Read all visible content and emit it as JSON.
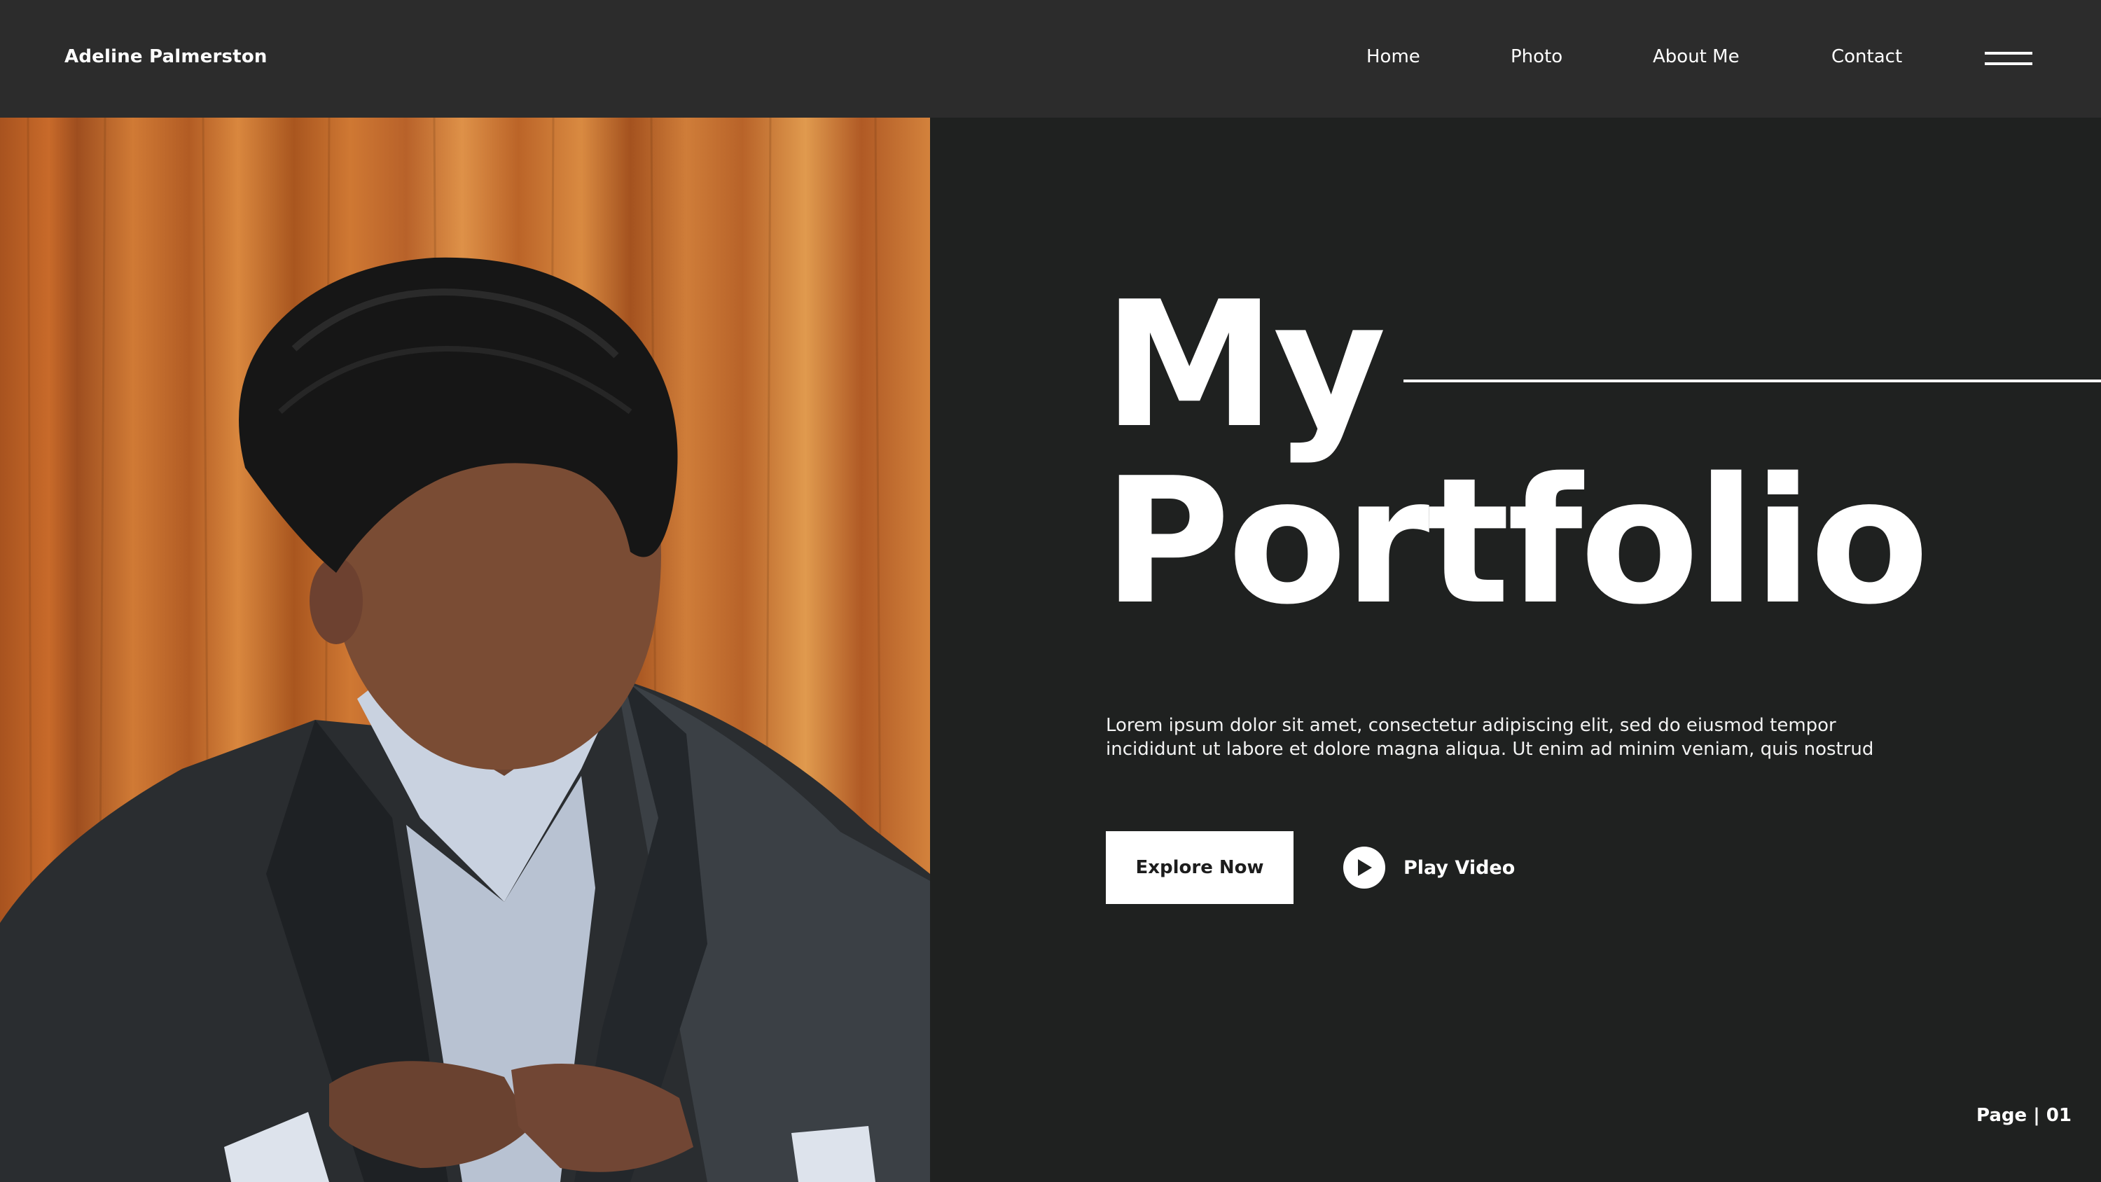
{
  "header": {
    "brand": "Adeline Palmerston",
    "nav": {
      "home": "Home",
      "photo": "Photo",
      "about": "About Me",
      "contact": "Contact"
    },
    "menu_icon": "hamburger-icon"
  },
  "hero": {
    "title_line1": "My",
    "title_line2": "Portfolio",
    "description": "Lorem ipsum dolor sit amet, consectetur adipiscing elit, sed do eiusmod tempor incididunt ut labore et dolore magna aliqua. Ut enim ad minim veniam, quis nostrud",
    "explore_label": "Explore Now",
    "play_label": "Play Video",
    "play_icon": "play-icon"
  },
  "footer": {
    "page_label": "Page | 01"
  },
  "colors": {
    "background": "#1f2120",
    "header": "#2c2c2c",
    "text": "#ffffff",
    "button_bg": "#ffffff",
    "button_text": "#1d1d1d"
  }
}
